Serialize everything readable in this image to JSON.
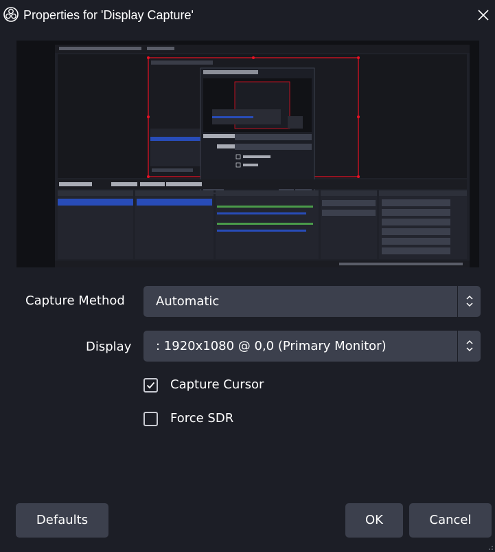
{
  "window": {
    "title": "Properties for 'Display Capture'",
    "logo_icon": "obs-logo-icon",
    "close_icon": "close-icon"
  },
  "preview": {
    "description_icon": "display-capture-preview",
    "mini_docks": [
      "Scenes",
      "Sources",
      "Audio Mixer",
      "Scene Transitions",
      "Controls"
    ],
    "mini_controls": [
      "Start Streaming",
      "Start Recording",
      "Start Virtual Camera",
      "Studio Mode",
      "Settings",
      "Exit"
    ],
    "mini_source": "Display Capture",
    "mini_scene": "Scene",
    "mini_buttons": [
      "Properties",
      "Filters",
      "Display"
    ],
    "mini_dialog_title": "Properties for 'Display Capture'",
    "mini_defaults": "Defaults",
    "mini_ok": "OK",
    "mini_cancel": "Cancel"
  },
  "form": {
    "capture_method_label": "Capture Method",
    "capture_method_value": "Automatic",
    "display_label": "Display",
    "display_value": ": 1920x1080 @ 0,0 (Primary Monitor)",
    "capture_cursor_label": "Capture Cursor",
    "capture_cursor_checked": true,
    "force_sdr_label": "Force SDR",
    "force_sdr_checked": false
  },
  "buttons": {
    "defaults": "Defaults",
    "ok": "OK",
    "cancel": "Cancel"
  },
  "colors": {
    "background": "#1c1e26",
    "control": "#3c404d",
    "accent_blue": "#284cb8",
    "selection_red": "#e81123"
  }
}
